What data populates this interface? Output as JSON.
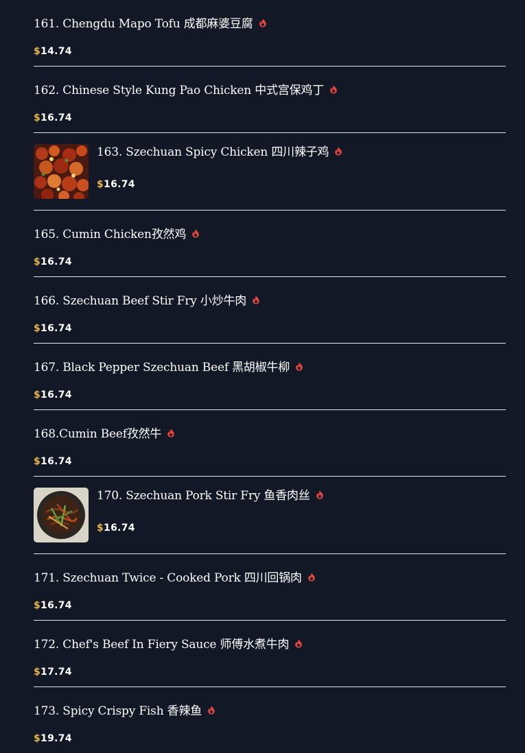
{
  "menu": {
    "items": [
      {
        "title": "161. Chengdu Mapo Tofu 成都麻婆豆腐",
        "price": "14.74",
        "spicy": true,
        "image": false
      },
      {
        "title": "162. Chinese Style Kung Pao Chicken 中式宫保鸡丁",
        "price": "16.74",
        "spicy": true,
        "image": false
      },
      {
        "title": "163. Szechuan Spicy Chicken 四川辣子鸡",
        "price": "16.74",
        "spicy": true,
        "image": true,
        "image_name": "spicy-chicken-photo"
      },
      {
        "title": "165. Cumin Chicken孜然鸡",
        "price": "16.74",
        "spicy": true,
        "image": false
      },
      {
        "title": "166. Szechuan Beef Stir Fry 小炒牛肉",
        "price": "16.74",
        "spicy": true,
        "image": false
      },
      {
        "title": "167. Black Pepper Szechuan Beef 黑胡椒牛柳",
        "price": "16.74",
        "spicy": true,
        "image": false
      },
      {
        "title": "168.Cumin Beef孜然牛",
        "price": "16.74",
        "spicy": true,
        "image": false
      },
      {
        "title": "170. Szechuan Pork Stir Fry 鱼香肉丝",
        "price": "16.74",
        "spicy": true,
        "image": true,
        "image_name": "pork-stir-fry-photo"
      },
      {
        "title": "171. Szechuan Twice - Cooked Pork 四川回锅肉",
        "price": "16.74",
        "spicy": true,
        "image": false
      },
      {
        "title": "172. Chef's Beef In Fiery Sauce 师傅水煮牛肉",
        "price": "17.74",
        "spicy": true,
        "image": false
      },
      {
        "title": "173. Spicy Crispy Fish 香辣鱼",
        "price": "19.74",
        "spicy": true,
        "image": false
      }
    ],
    "currency_symbol": "$"
  },
  "colors": {
    "background": "#131826",
    "text": "#ffffff",
    "price_symbol": "#e8b54a",
    "spicy_icon": "#e2463d",
    "divider": "#e3e5ea"
  },
  "icons": {
    "spicy": "flame-icon"
  }
}
